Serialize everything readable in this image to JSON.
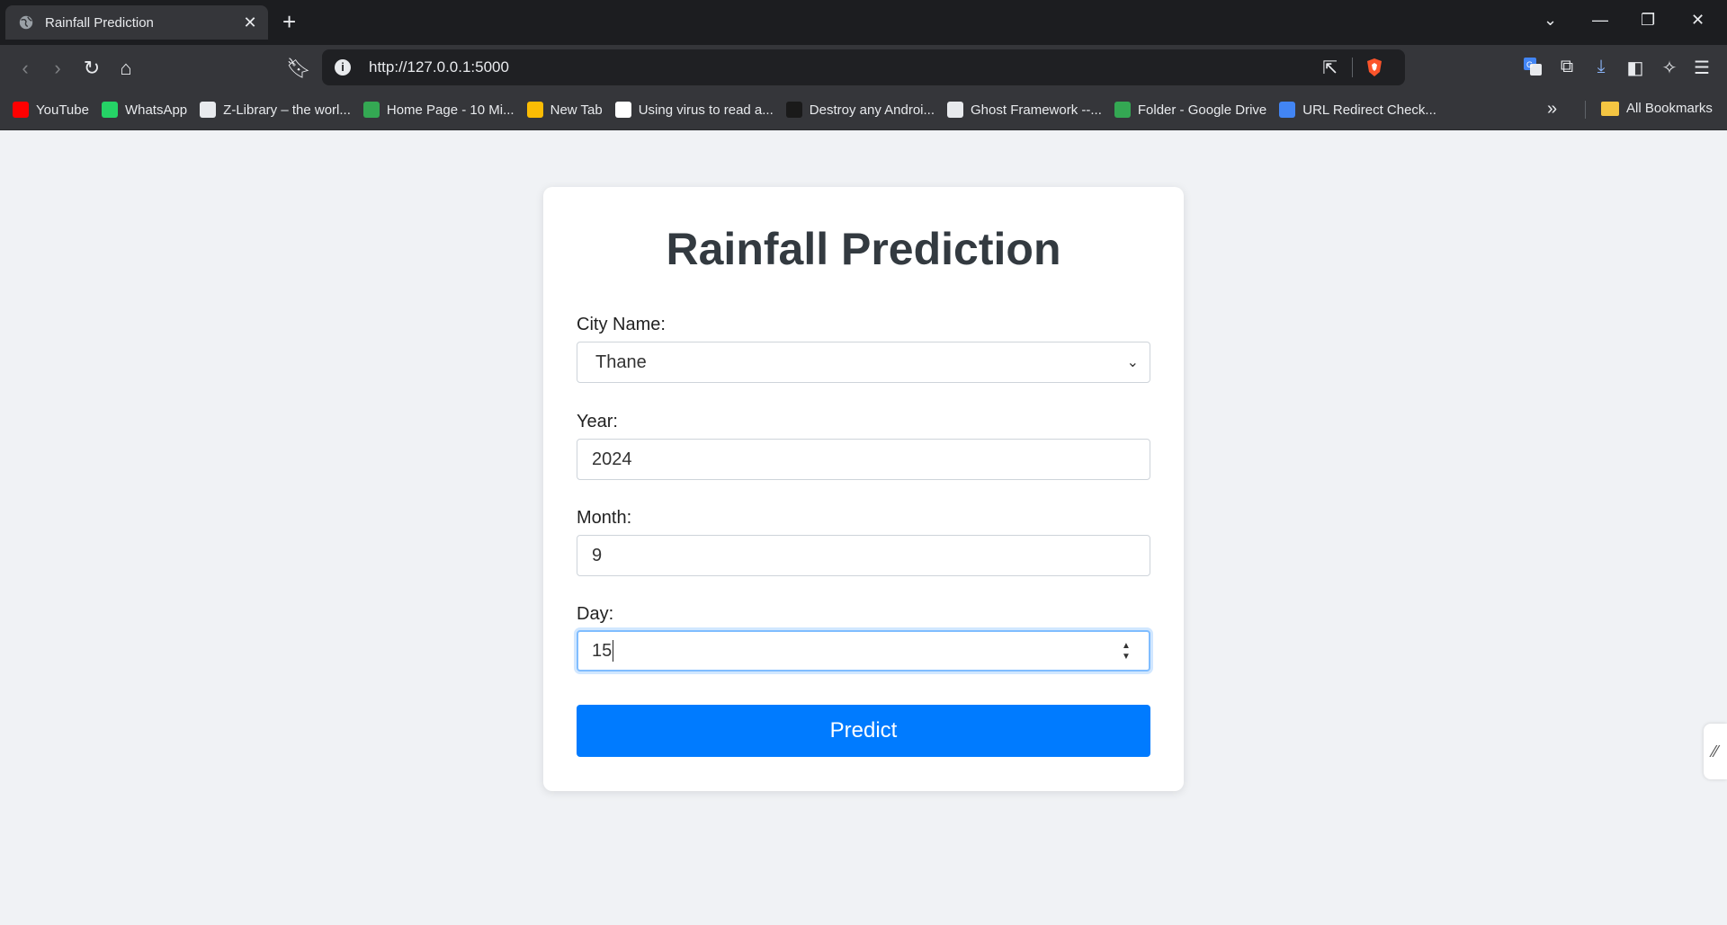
{
  "browser": {
    "tab_title": "Rainfall Prediction",
    "url": "http://127.0.0.1:5000",
    "bookmarks": [
      {
        "label": "YouTube",
        "color": "#ff0000"
      },
      {
        "label": "WhatsApp",
        "color": "#25d366"
      },
      {
        "label": "Z-Library – the worl...",
        "color": "#e8eaed"
      },
      {
        "label": "Home Page - 10 Mi...",
        "color": "#34a853"
      },
      {
        "label": "New Tab",
        "color": "#fbbc04"
      },
      {
        "label": "Using virus to read a...",
        "color": "#ffffff"
      },
      {
        "label": "Destroy any Androi...",
        "color": "#1a1a1a"
      },
      {
        "label": "Ghost Framework --...",
        "color": "#e8eaed"
      },
      {
        "label": "Folder - Google Drive",
        "color": "#34a853"
      },
      {
        "label": "URL Redirect Check...",
        "color": "#4285f4"
      }
    ],
    "all_bookmarks": "All Bookmarks"
  },
  "form": {
    "title": "Rainfall Prediction",
    "city_label": "City Name:",
    "city_value": "Thane",
    "year_label": "Year:",
    "year_value": "2024",
    "month_label": "Month:",
    "month_value": "9",
    "day_label": "Day:",
    "day_value": "15",
    "submit_label": "Predict"
  },
  "colors": {
    "accent": "#007bff",
    "page_bg": "#f0f2f5"
  }
}
